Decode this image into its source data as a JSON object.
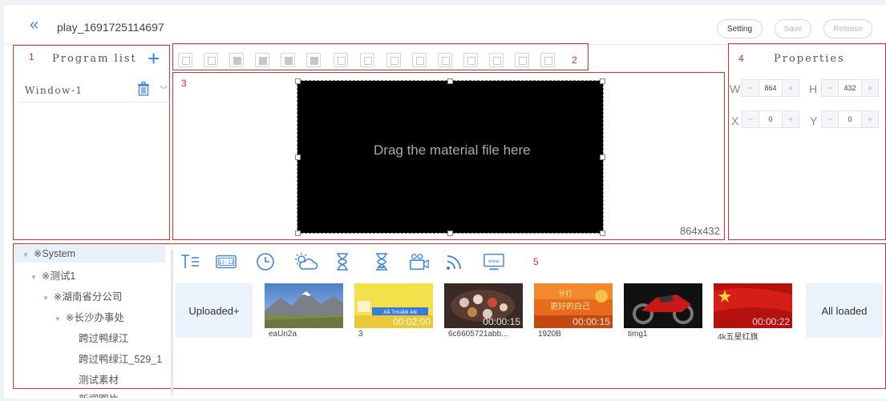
{
  "header": {
    "back_icon": "double-chevron-left-icon",
    "title": "play_1691725114697",
    "setting_label": "Setting",
    "save_label": "Save",
    "release_label": "Release"
  },
  "annotations": {
    "n1": "1",
    "n2": "2",
    "n3": "3",
    "n4": "4",
    "n5": "5"
  },
  "program_list": {
    "title": "Program list",
    "windows": [
      {
        "label": "Window-1"
      }
    ]
  },
  "toolbar": {
    "tools": [
      "expand-icon",
      "shrink-icon",
      "bring-front-icon",
      "send-back-icon",
      "move-up-icon",
      "move-down-icon",
      "fit-full-icon",
      "align-bottom-edge-icon",
      "align-right-edge-icon",
      "align-bottom-icon",
      "center-vertical-icon",
      "align-top-icon",
      "align-left-icon",
      "center-horizontal-icon",
      "align-right-icon"
    ]
  },
  "canvas": {
    "hint": "Drag the material file here",
    "resolution": "864x432"
  },
  "properties": {
    "title": "Properties",
    "w_label": "W",
    "w_value": "864",
    "h_label": "H",
    "h_value": "432",
    "x_label": "X",
    "x_value": "0",
    "y_label": "Y",
    "y_value": "0",
    "minus": "−",
    "plus": "+"
  },
  "tree": {
    "items": [
      {
        "label": "※System"
      },
      {
        "label": "※测试1"
      },
      {
        "label": "※湖南省分公司"
      },
      {
        "label": "※长沙办事处"
      },
      {
        "label": "跨过鸭绿江"
      },
      {
        "label": "跨过鸭绿江_529_1"
      },
      {
        "label": "测试素材"
      },
      {
        "label": "新闻图片"
      }
    ]
  },
  "widgets": [
    "text-icon",
    "clock-digital-icon",
    "clock-analog-icon",
    "weather-icon",
    "hourglass-icon",
    "countdown-icon",
    "camera-icon",
    "rss-icon",
    "webpage-icon"
  ],
  "materials": {
    "uploaded_label": "Uploaded+",
    "all_loaded_label": "All loaded",
    "items": [
      {
        "name": "eaUn2a",
        "duration": ""
      },
      {
        "name": "3",
        "duration": "00:02:00"
      },
      {
        "name": "6c6605721abb...",
        "duration": "00:00:15"
      },
      {
        "name": "1920B",
        "duration": "00:00:15"
      },
      {
        "name": "timg1",
        "duration": ""
      },
      {
        "name": "4k五星红旗",
        "duration": "00:00:22"
      }
    ]
  },
  "colors": {
    "accent": "#3b82e6",
    "annotation": "#d93030"
  }
}
